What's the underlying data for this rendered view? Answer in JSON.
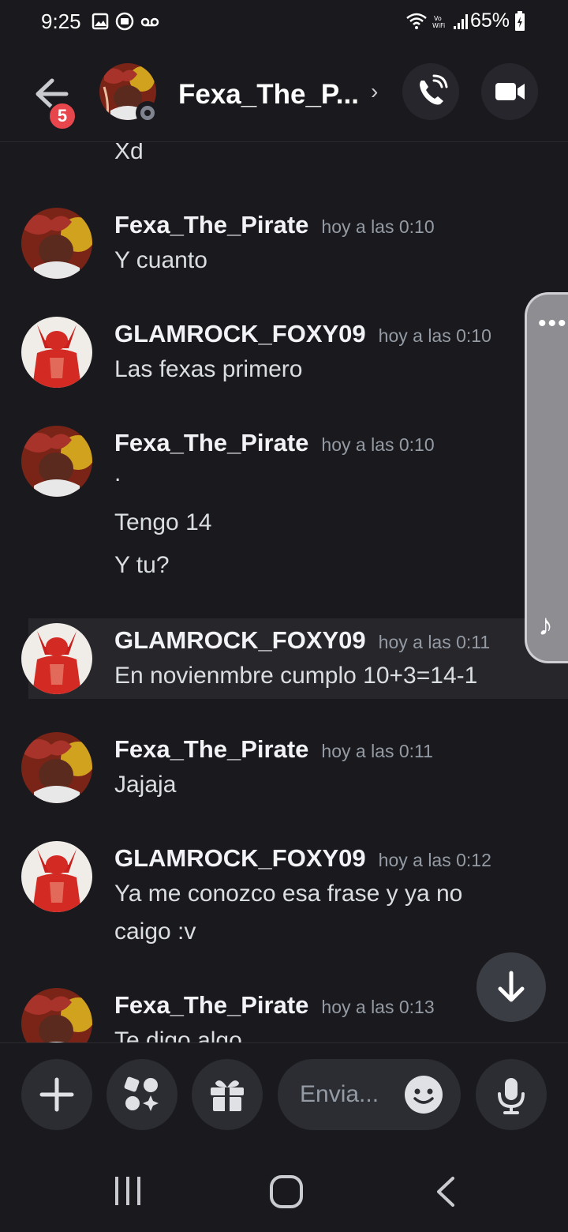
{
  "status_bar": {
    "time": "9:25",
    "battery": "65%"
  },
  "header": {
    "title": "Fexa_The_P...",
    "unread_badge": "5"
  },
  "messages": [
    {
      "author": "",
      "timestamp": "",
      "lines": [
        "Xd"
      ]
    },
    {
      "author": "Fexa_The_Pirate",
      "timestamp": "hoy a las 0:10",
      "lines": [
        "Y cuanto"
      ]
    },
    {
      "author": "GLAMROCK_FOXY09",
      "timestamp": "hoy a las 0:10",
      "lines": [
        "Las fexas primero"
      ]
    },
    {
      "author": "Fexa_The_Pirate",
      "timestamp": "hoy a las 0:10",
      "lines": [
        ".",
        "Tengo 14",
        "Y tu?"
      ]
    },
    {
      "author": "GLAMROCK_FOXY09",
      "timestamp": "hoy a las 0:11",
      "lines": [
        "En novienmbre cumplo 10+3=14-1"
      ]
    },
    {
      "author": "Fexa_The_Pirate",
      "timestamp": "hoy a las 0:11",
      "lines": [
        "Jajaja"
      ]
    },
    {
      "author": "GLAMROCK_FOXY09",
      "timestamp": "hoy a las 0:12",
      "lines": [
        "Ya me conozco esa frase y ya no",
        "caigo :v"
      ]
    },
    {
      "author": "Fexa_The_Pirate",
      "timestamp": "hoy a las 0:13",
      "lines": [
        "Te digo algo"
      ]
    }
  ],
  "composer": {
    "placeholder": "Envia..."
  },
  "icons": {
    "back": "arrow-left-icon",
    "call": "phone-icon",
    "video": "video-camera-icon",
    "add": "plus-icon",
    "apps": "apps-icon",
    "gift": "gift-icon",
    "emoji": "smiley-icon",
    "mic": "microphone-icon",
    "jump": "arrow-down-icon"
  },
  "colors": {
    "background": "#1a1a1e",
    "badge": "#e7474c",
    "panel": "#2b2d33"
  }
}
